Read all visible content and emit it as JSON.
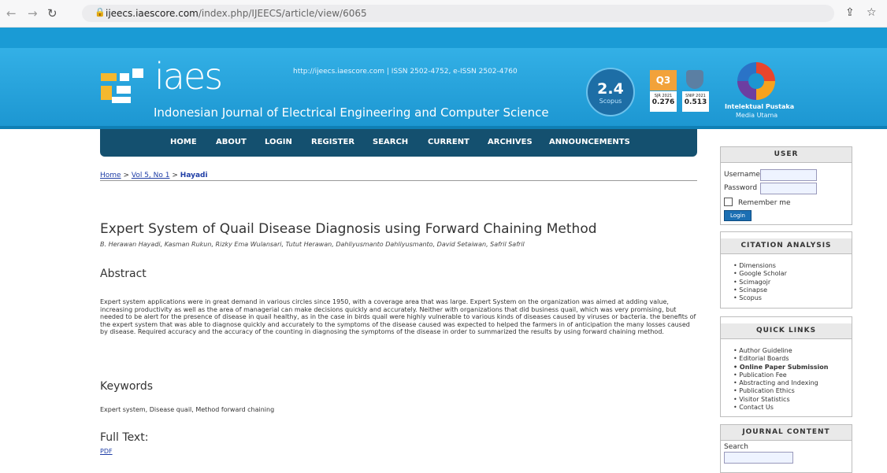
{
  "browser": {
    "url_domain": "ijeecs.iaescore.com",
    "url_path": "/index.php/IJEECS/article/view/6065"
  },
  "header": {
    "logo_text": "iaes",
    "journal_name": "Indonesian Journal of Electrical Engineering and Computer Science",
    "issn": "http://ijeecs.iaescore.com  |  ISSN 2502-4752, e-ISSN 2502-4760",
    "citescore_value": "2.4",
    "citescore_label": "Scopus",
    "quartile": "Q3",
    "sjr_label": "SJR 2021",
    "sjr_value": "0.276",
    "snip_label": "SNIP 2021",
    "snip_value": "0.513",
    "publisher": "Intelektual Pustaka",
    "publisher_sub": "Media Utama"
  },
  "menu": [
    "HOME",
    "ABOUT",
    "LOGIN",
    "REGISTER",
    "SEARCH",
    "CURRENT",
    "ARCHIVES",
    "ANNOUNCEMENTS"
  ],
  "breadcrumb": {
    "home": "Home",
    "sep": ">",
    "issue": "Vol 5, No 1",
    "current": "Hayadi"
  },
  "article": {
    "title": "Expert System of Quail Disease Diagnosis using Forward Chaining Method",
    "authors": "B. Herawan Hayadi, Kasman Rukun, Rizky Ema Wulansari, Tutut Herawan, Dahliyusmanto Dahliyusmanto, David Setaiwan, Safril Safril",
    "abstract_heading": "Abstract",
    "abstract": "Expert system applications were in great demand in various circles since 1950, with a coverage area that was large. Expert System on the organization was aimed at adding value, increasing productivity as well as the area of managerial can make decisions quickly and accurately. Neither with organizations that did business quail, which was very promising, but needed to be alert for the presence of disease in quail healthy, as in the case in birds quail were highly vulnerable to various kinds of diseases caused by viruses or bacteria. the benefits of the expert system that was able to diagnose quickly and accurately to the symptoms of the disease caused was expected to helped the farmers in of anticipation the many losses caused by disease. Required accuracy and the accuracy of the counting in diagnosing the symptoms of the disease in order to summarized the results by using forward chaining method.",
    "keywords_heading": "Keywords",
    "keywords": "Expert system, Disease quail, Method forward chaining",
    "fulltext_heading": "Full Text:",
    "pdf": "PDF"
  },
  "sidebar": {
    "user": {
      "heading": "USER",
      "username": "Username",
      "password": "Password",
      "remember": "Remember me",
      "login": "Login"
    },
    "citation": {
      "heading": "CITATION ANALYSIS",
      "items": [
        "Dimensions",
        "Google Scholar",
        "Scimagojr",
        "Scinapse",
        "Scopus"
      ]
    },
    "quick_links": {
      "heading": "QUICK LINKS",
      "items": [
        "Author Guideline",
        "Editorial Boards",
        "Online Paper Submission",
        "Publication Fee",
        "Abstracting and Indexing",
        "Publication Ethics",
        "Visitor Statistics",
        "Contact Us"
      ]
    },
    "journal_content": {
      "heading": "JOURNAL CONTENT",
      "search": "Search"
    }
  },
  "colors": {
    "banner": "#1c96d1",
    "menu": "#14506f",
    "link": "#1f3ea6",
    "login_button": "#1b6fb3"
  }
}
